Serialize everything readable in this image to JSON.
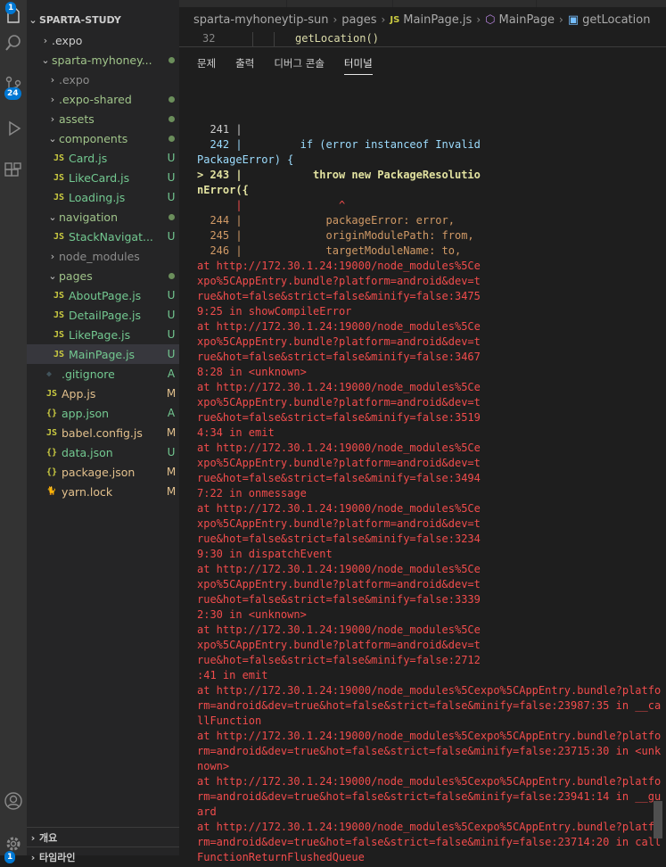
{
  "activity_bar": {
    "explorer_badge": "1",
    "scm_badge": "24",
    "settings_badge": "1"
  },
  "sidebar": {
    "title": "SPARTA-STUDY",
    "items": [
      {
        "label": ".expo",
        "indent": 0,
        "chevron": "right",
        "icon": "",
        "status": ""
      },
      {
        "label": "sparta-myhoney...",
        "indent": 0,
        "chevron": "down",
        "icon": "",
        "status": "dot"
      },
      {
        "label": ".expo",
        "indent": 1,
        "chevron": "right",
        "icon": "",
        "status": ""
      },
      {
        "label": ".expo-shared",
        "indent": 1,
        "chevron": "right",
        "icon": "",
        "status": "dot"
      },
      {
        "label": "assets",
        "indent": 1,
        "chevron": "right",
        "icon": "",
        "status": "dot"
      },
      {
        "label": "components",
        "indent": 1,
        "chevron": "down",
        "icon": "",
        "status": "dot"
      },
      {
        "label": "Card.js",
        "indent": 2,
        "chevron": "",
        "icon": "JS",
        "status": "U"
      },
      {
        "label": "LikeCard.js",
        "indent": 2,
        "chevron": "",
        "icon": "JS",
        "status": "U"
      },
      {
        "label": "Loading.js",
        "indent": 2,
        "chevron": "",
        "icon": "JS",
        "status": "U"
      },
      {
        "label": "navigation",
        "indent": 1,
        "chevron": "down",
        "icon": "",
        "status": "dot"
      },
      {
        "label": "StackNavigat...",
        "indent": 2,
        "chevron": "",
        "icon": "JS",
        "status": "U"
      },
      {
        "label": "node_modules",
        "indent": 1,
        "chevron": "right",
        "icon": "",
        "status": ""
      },
      {
        "label": "pages",
        "indent": 1,
        "chevron": "down",
        "icon": "",
        "status": "dot"
      },
      {
        "label": "AboutPage.js",
        "indent": 2,
        "chevron": "",
        "icon": "JS",
        "status": "U"
      },
      {
        "label": "DetailPage.js",
        "indent": 2,
        "chevron": "",
        "icon": "JS",
        "status": "U"
      },
      {
        "label": "LikePage.js",
        "indent": 2,
        "chevron": "",
        "icon": "JS",
        "status": "U"
      },
      {
        "label": "MainPage.js",
        "indent": 2,
        "chevron": "",
        "icon": "JS",
        "status": "U",
        "selected": true
      },
      {
        "label": ".gitignore",
        "indent": 1,
        "chevron": "",
        "icon": "git",
        "status": "A"
      },
      {
        "label": "App.js",
        "indent": 1,
        "chevron": "",
        "icon": "JS",
        "status": "M"
      },
      {
        "label": "app.json",
        "indent": 1,
        "chevron": "",
        "icon": "{}",
        "status": "A"
      },
      {
        "label": "babel.config.js",
        "indent": 1,
        "chevron": "",
        "icon": "JS",
        "status": "M"
      },
      {
        "label": "data.json",
        "indent": 1,
        "chevron": "",
        "icon": "{}",
        "status": "U"
      },
      {
        "label": "package.json",
        "indent": 1,
        "chevron": "",
        "icon": "{}",
        "status": "M"
      },
      {
        "label": "yarn.lock",
        "indent": 1,
        "chevron": "",
        "icon": "yarn",
        "status": "M"
      }
    ],
    "bottom_sections": [
      "개요",
      "타임라인"
    ]
  },
  "breadcrumb": {
    "parts": [
      "sparta-myhoneytip-sun",
      "pages",
      "MainPage.js",
      "MainPage",
      "getLocation"
    ]
  },
  "code_line": {
    "number": "32",
    "text": "getLocation()"
  },
  "panel": {
    "tabs": [
      "문제",
      "출력",
      "디버그 콘솔",
      "터미널"
    ],
    "active_tab": "터미널"
  },
  "terminal": {
    "lines": [
      "",
      "  241 |",
      "  242 |         if (error instanceof Invalid",
      "PackageError) {",
      "> 243 |           throw new PackageResolutio",
      "nError({",
      "      |               ^",
      "  244 |             packageError: error,",
      "  245 |             originModulePath: from,",
      "  246 |             targetModuleName: to,",
      "at http://172.30.1.24:19000/node_modules%5Ce",
      "xpo%5CAppEntry.bundle?platform=android&dev=t",
      "rue&hot=false&strict=false&minify=false:3475",
      "9:25 in showCompileError",
      "at http://172.30.1.24:19000/node_modules%5Ce",
      "xpo%5CAppEntry.bundle?platform=android&dev=t",
      "rue&hot=false&strict=false&minify=false:3467",
      "8:28 in <unknown>",
      "at http://172.30.1.24:19000/node_modules%5Ce",
      "xpo%5CAppEntry.bundle?platform=android&dev=t",
      "rue&hot=false&strict=false&minify=false:3519",
      "4:34 in emit",
      "at http://172.30.1.24:19000/node_modules%5Ce",
      "xpo%5CAppEntry.bundle?platform=android&dev=t",
      "rue&hot=false&strict=false&minify=false:3494",
      "7:22 in onmessage",
      "at http://172.30.1.24:19000/node_modules%5Ce",
      "xpo%5CAppEntry.bundle?platform=android&dev=t",
      "rue&hot=false&strict=false&minify=false:3234",
      "9:30 in dispatchEvent",
      "at http://172.30.1.24:19000/node_modules%5Ce",
      "xpo%5CAppEntry.bundle?platform=android&dev=t",
      "rue&hot=false&strict=false&minify=false:3339",
      "2:30 in <unknown>",
      "at http://172.30.1.24:19000/node_modules%5Ce",
      "xpo%5CAppEntry.bundle?platform=android&dev=t",
      "rue&hot=false&strict=false&minify=false:2712",
      ":41 in emit",
      "at http://172.30.1.24:19000/node_modules%5Cexpo%5CAppEntry.bundle?platfo",
      "rm=android&dev=true&hot=false&strict=false&minify=false:23987:35 in __ca",
      "llFunction",
      "at http://172.30.1.24:19000/node_modules%5Cexpo%5CAppEntry.bundle?platfo",
      "rm=android&dev=true&hot=false&strict=false&minify=false:23715:30 in <unk",
      "nown>",
      "at http://172.30.1.24:19000/node_modules%5Cexpo%5CAppEntry.bundle?platfo",
      "rm=android&dev=true&hot=false&strict=false&minify=false:23941:14 in __gu",
      "ard",
      "at http://172.30.1.24:19000/node_modules%5Cexpo%5CAppEntry.bundle?platfo",
      "rm=android&dev=true&hot=false&strict=false&minify=false:23714:20 in call",
      "FunctionReturnFlushedQueue"
    ]
  },
  "colors": {
    "activity_bg": "#333333",
    "sidebar_bg": "#252526",
    "editor_bg": "#1e1e1e",
    "terminal_error": "#f14c4c",
    "badge": "#0078d4",
    "untracked": "#73c991",
    "modified": "#e2c08d",
    "js_icon": "#cbcb41",
    "json_icon": "#cbcb41"
  }
}
